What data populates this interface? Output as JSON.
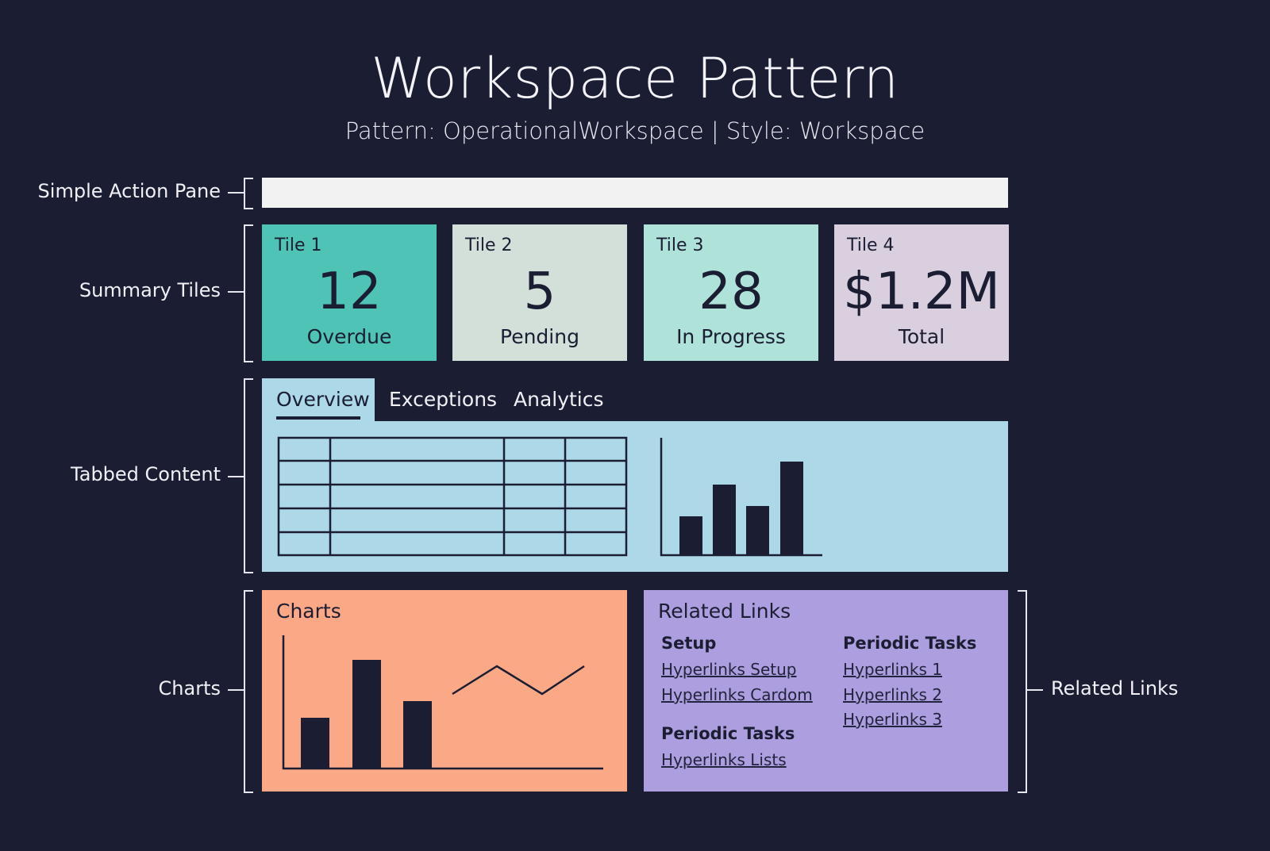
{
  "header": {
    "title": "Workspace Pattern",
    "subtitle": "Pattern: OperationalWorkspace | Style: Workspace"
  },
  "annotations": {
    "action_pane": "Simple Action Pane",
    "summary_tiles": "Summary Tiles",
    "tabbed_content": "Tabbed Content",
    "charts": "Charts",
    "related_links": "Related Links"
  },
  "tiles": [
    {
      "label": "Tile 1",
      "value": "12",
      "caption": "Overdue",
      "color": "#4fc4b6"
    },
    {
      "label": "Tile 2",
      "value": "5",
      "caption": "Pending",
      "color": "#d3e0da"
    },
    {
      "label": "Tile 3",
      "value": "28",
      "caption": "In Progress",
      "color": "#afe2d8"
    },
    {
      "label": "Tile 4",
      "value": "$1.2M",
      "caption": "Total",
      "color": "#d9cfdf"
    }
  ],
  "tabs": {
    "overview": "Overview",
    "exceptions": "Exceptions",
    "analytics": "Analytics"
  },
  "charts_panel": {
    "title": "Charts"
  },
  "related_links": {
    "title": "Related Links",
    "setup_title": "Setup",
    "setup_links": [
      "Hyperlinks Setup",
      "Hyperlinks Cardom"
    ],
    "periodic_title_left": "Periodic Tasks",
    "periodic_links_left": [
      "Hyperlinks Lists"
    ],
    "periodic_title_right": "Periodic Tasks",
    "periodic_links_right": [
      "Hyperlinks 1",
      "Hyperlinks 2",
      "Hyperlinks 3"
    ]
  },
  "colors": {
    "background": "#1b1d33",
    "action_pane": "#f2f2f2",
    "tabbed_panel": "#acd8e8",
    "charts_panel": "#fba886",
    "links_panel": "#ad9fdf"
  }
}
